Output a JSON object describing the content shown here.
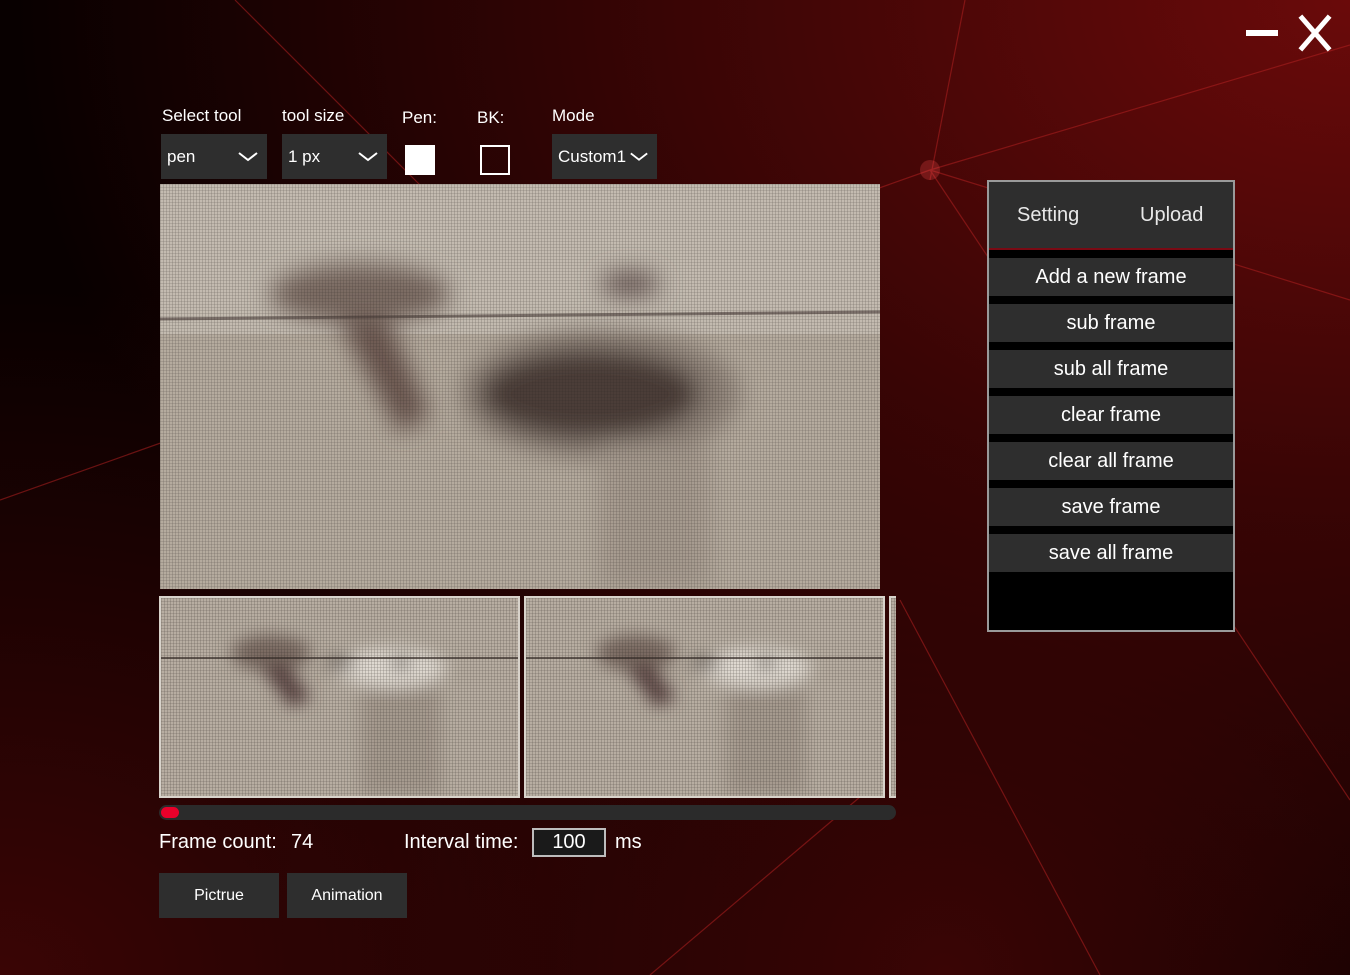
{
  "window": {
    "minimize_icon": "minimize-icon",
    "close_icon": "close-icon"
  },
  "toolbar": {
    "select_tool": {
      "label": "Select tool",
      "value": "pen"
    },
    "tool_size": {
      "label": "tool size",
      "value": "1 px"
    },
    "pen": {
      "label": "Pen:",
      "color": "#ffffff"
    },
    "bk": {
      "label": "BK:",
      "color": "transparent"
    },
    "mode": {
      "label": "Mode",
      "value": "Custom1"
    }
  },
  "frames": {
    "count_label": "Frame count:",
    "count_value": "74",
    "interval_label": "Interval time:",
    "interval_value": "100",
    "interval_unit": "ms",
    "scroll_position": 0.0
  },
  "bottom_buttons": {
    "picture": "Pictrue",
    "animation": "Animation"
  },
  "panel": {
    "tabs": [
      "Setting",
      "Upload"
    ],
    "buttons": [
      "Add a new frame",
      "sub frame",
      "sub all frame",
      "clear frame",
      "clear all frame",
      "save frame",
      "save all frame"
    ]
  },
  "colors": {
    "accent": "#e8002a",
    "panel_bg": "#2e2e2e",
    "canvas_tone": "#a89e90"
  }
}
